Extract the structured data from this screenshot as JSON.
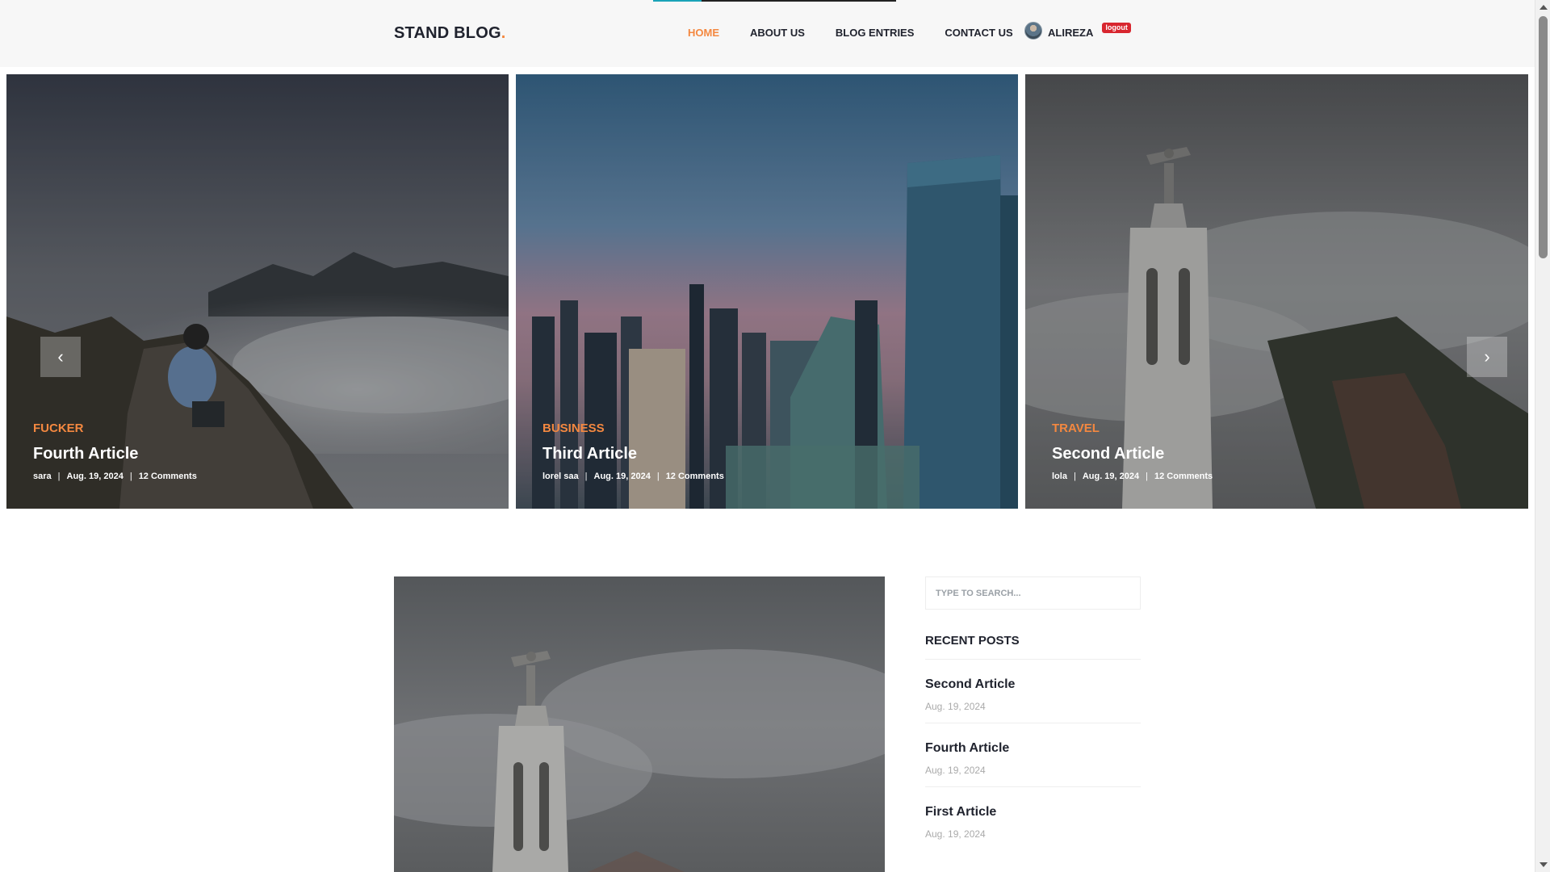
{
  "header": {
    "logo_text": "STAND BLOG",
    "logo_dot": ".",
    "nav": [
      {
        "label": "HOME",
        "active": true
      },
      {
        "label": "ABOUT US"
      },
      {
        "label": "BLOG ENTRIES"
      },
      {
        "label": "CONTACT US"
      }
    ],
    "user": {
      "name": "ALIREZA",
      "logout_label": "logout"
    }
  },
  "slider": {
    "prev_icon": "‹",
    "next_icon": "›",
    "slides": [
      {
        "category": "FUCKER",
        "title": "Fourth Article",
        "author": "sara",
        "date": "Aug. 19, 2024",
        "comments": "12 Comments"
      },
      {
        "category": "BUSINESS",
        "title": "Third Article",
        "author": "lorel saa",
        "date": "Aug. 19, 2024",
        "comments": "12 Comments"
      },
      {
        "category": "TRAVEL",
        "title": "Second Article",
        "author": "lola",
        "date": "Aug. 19, 2024",
        "comments": "12 Comments"
      }
    ]
  },
  "sidebar": {
    "search_placeholder": "TYPE TO SEARCH...",
    "recent_heading": "RECENT POSTS",
    "recent_posts": [
      {
        "title": "Second Article",
        "date": "Aug. 19, 2024"
      },
      {
        "title": "Fourth Article",
        "date": "Aug. 19, 2024"
      },
      {
        "title": "First Article",
        "date": "Aug. 19, 2024"
      }
    ]
  },
  "colors": {
    "accent": "#f48840",
    "dark_text": "#20232e",
    "logout_red": "#d8262f",
    "teal_accent": "#1aa3b8"
  }
}
